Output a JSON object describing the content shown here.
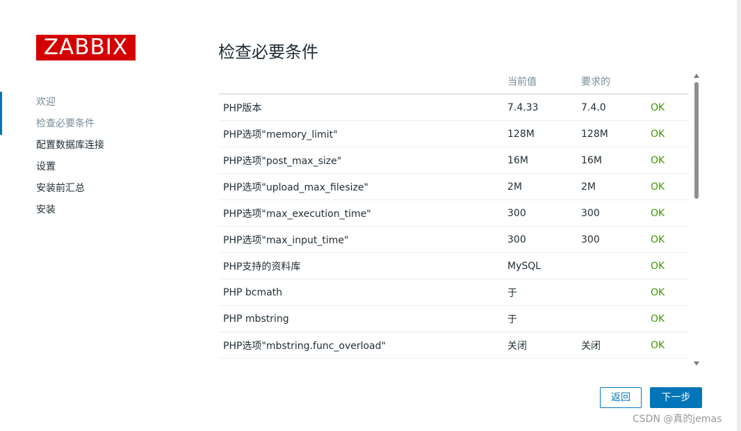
{
  "logo": {
    "text": "ZABBIX",
    "color": "#d40000"
  },
  "nav": {
    "items": [
      {
        "label": "欢迎",
        "state": "done"
      },
      {
        "label": "检查必要条件",
        "state": "current"
      },
      {
        "label": "配置数据库连接",
        "state": "pending"
      },
      {
        "label": "设置",
        "state": "pending"
      },
      {
        "label": "安装前汇总",
        "state": "pending"
      },
      {
        "label": "安装",
        "state": "pending"
      }
    ]
  },
  "page": {
    "title": "检查必要条件"
  },
  "table": {
    "headers": [
      "",
      "当前值",
      "要求的",
      ""
    ],
    "rows": [
      {
        "name": "PHP版本",
        "current": "7.4.33",
        "required": "7.4.0",
        "status": "OK"
      },
      {
        "name": "PHP选项\"memory_limit\"",
        "current": "128M",
        "required": "128M",
        "status": "OK"
      },
      {
        "name": "PHP选项\"post_max_size\"",
        "current": "16M",
        "required": "16M",
        "status": "OK"
      },
      {
        "name": "PHP选项\"upload_max_filesize\"",
        "current": "2M",
        "required": "2M",
        "status": "OK"
      },
      {
        "name": "PHP选项\"max_execution_time\"",
        "current": "300",
        "required": "300",
        "status": "OK"
      },
      {
        "name": "PHP选项\"max_input_time\"",
        "current": "300",
        "required": "300",
        "status": "OK"
      },
      {
        "name": "PHP支持的资料库",
        "current": "MySQL",
        "required": "",
        "status": "OK"
      },
      {
        "name": "PHP bcmath",
        "current": "于",
        "required": "",
        "status": "OK"
      },
      {
        "name": "PHP mbstring",
        "current": "于",
        "required": "",
        "status": "OK"
      },
      {
        "name": "PHP选项\"mbstring.func_overload\"",
        "current": "关闭",
        "required": "关闭",
        "status": "OK"
      }
    ]
  },
  "buttons": {
    "back_label": "返回",
    "next_label": "下一步"
  },
  "watermark": "CSDN @真的jemas",
  "colors": {
    "accent": "#0275b8",
    "ok": "#3c9900",
    "brand": "#d40000"
  }
}
